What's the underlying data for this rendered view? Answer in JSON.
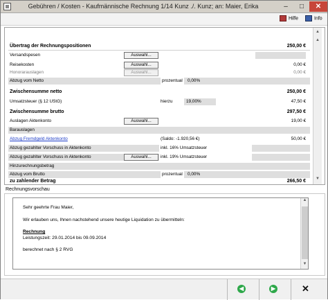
{
  "window": {
    "title": "Gebühren / Kosten - Kaufmännische Rechnung 1/14 Kunz ./. Kunz; an: Maier, Erika",
    "minimize": "–",
    "maximize": "□",
    "close": "✕"
  },
  "helpbar": {
    "help_label": "Hilfe",
    "info_label": "Info"
  },
  "rows": {
    "uebertrag": {
      "label": "Übertrag der Rechnungspositionen",
      "amount": "250,00 €"
    },
    "versandspesen": {
      "label": "Versandspesen",
      "button": "Auswahl..."
    },
    "reisekosten": {
      "label": "Reisekosten",
      "button": "Auswahl...",
      "amount": "0,00 €"
    },
    "honorarauslagen": {
      "label": "Honorarauslagen",
      "button": "Auswahl...",
      "amount": "0,00 €"
    },
    "abzug_netto": {
      "label": "Abzug vom Netto",
      "mode": "prozentual",
      "percent": "0,00%"
    },
    "zwischensumme_netto": {
      "label": "Zwischensumme netto",
      "amount": "250,00 €"
    },
    "umsatzsteuer": {
      "label": "Umsatzsteuer (§ 12 UStG)",
      "hierzu": "hierzu",
      "percent": "19,00%",
      "amount": "47,50 €"
    },
    "zwischensumme_brutto": {
      "label": "Zwischensumme brutto",
      "amount": "297,50 €"
    },
    "auslagen_aktenkonto": {
      "label": "Auslagen Aktenkonto",
      "button": "Auswahl...",
      "amount": "19,00 €"
    },
    "barauslagen": {
      "label": "Barauslagen"
    },
    "abzug_fremdgeld": {
      "label": "Abzug Fremdgeld Aktenkonto",
      "saldo": "(Saldo: -1.920,56 €)",
      "amount": "50,00 €"
    },
    "vorschuss_16": {
      "label": "Abzug gezahlter Vorschuss in Aktenkonto",
      "note": "inkl. 16% Umsatzsteuer"
    },
    "vorschuss_19": {
      "label": "Abzug gezahlter Vorschuss in Aktenkonto",
      "button": "Auswahl...",
      "note": "inkl. 19% Umsatzsteuer"
    },
    "hinzurechnungsbetrag": {
      "label": "Hinzurechnungsbetrag"
    },
    "abzug_brutto": {
      "label": "Abzug vom Brutto",
      "mode": "prozentual",
      "percent": "0,00%"
    },
    "zu_zahlender_betrag": {
      "label": "zu zahlender Betrag",
      "amount": "266,50 €"
    }
  },
  "preview": {
    "group_label": "Rechnungsvorschau",
    "salutation": "Sehr geehrte Frau Maier,",
    "intro": "Wir erlauben uns, Ihnen nachstehend unsere heutige Liquidation zu übermitteln:",
    "heading": "Rechnung",
    "period": "Leistungszeit: 29.01.2014 bis 09.09.2014",
    "basis": "berechnet nach § 2 RVG"
  },
  "bottom": {
    "back": "◀",
    "forward": "▶",
    "cancel": "✕"
  },
  "colors": {
    "link": "#1f3ec8",
    "nav_green": "#2ea84a",
    "field_gray": "#dedede"
  }
}
